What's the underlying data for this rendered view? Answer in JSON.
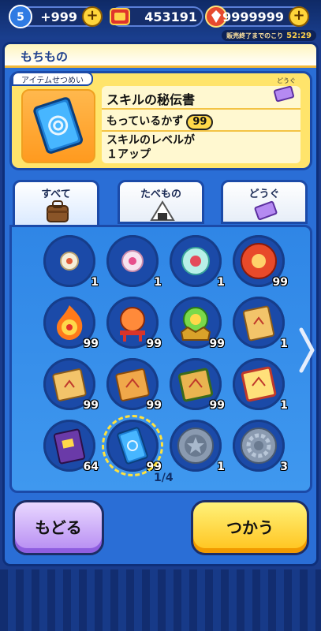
{
  "currency": {
    "stamina": {
      "level": "5",
      "value": "+999"
    },
    "coins": {
      "value": "453191"
    },
    "gems": {
      "value": "9999999"
    },
    "timer_label": "販売終了までのこり",
    "timer_value": "52:29"
  },
  "window": {
    "title": "もちもの",
    "info_tab": "アイテムせつめい",
    "item_name": "スキルの秘伝書",
    "owned_label": "もっているかず",
    "owned_count": "99",
    "description": "スキルのレベルが\n１アップ",
    "category_badge": "どうぐ"
  },
  "tabs": [
    {
      "label": "すべて",
      "active": true
    },
    {
      "label": "たべもの",
      "active": false
    },
    {
      "label": "どうぐ",
      "active": false
    }
  ],
  "items": [
    {
      "icon": "pale-orb-icon",
      "count": "1"
    },
    {
      "icon": "pink-orb-icon",
      "count": "1"
    },
    {
      "icon": "teal-orb-icon",
      "count": "1"
    },
    {
      "icon": "red-orb-icon",
      "count": "99"
    },
    {
      "icon": "fire-orb-icon",
      "count": "99"
    },
    {
      "icon": "shrine-orb-icon",
      "count": "99"
    },
    {
      "icon": "crown-orb-icon",
      "count": "99"
    },
    {
      "icon": "scroll-book-icon",
      "count": "1"
    },
    {
      "icon": "gold-book-icon",
      "count": "99"
    },
    {
      "icon": "orange-book-icon",
      "count": "99"
    },
    {
      "icon": "green-book-icon",
      "count": "99"
    },
    {
      "icon": "rainbow-book-icon",
      "count": "1"
    },
    {
      "icon": "purple-book-icon",
      "count": "64"
    },
    {
      "icon": "skill-book-icon",
      "count": "99",
      "selected": true
    },
    {
      "icon": "star-medal-icon",
      "count": "1"
    },
    {
      "icon": "gear-medal-icon",
      "count": "3"
    }
  ],
  "pagination": "1/4",
  "buttons": {
    "back": "もどる",
    "use": "つかう"
  }
}
